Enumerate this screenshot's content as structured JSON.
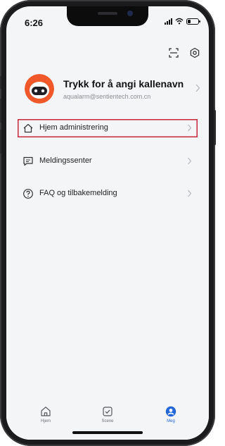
{
  "status_bar": {
    "time": "6:26",
    "battery_level": 0.3
  },
  "top_actions": {
    "scan_icon": "scan-icon",
    "settings_icon": "settings-gear-icon"
  },
  "profile": {
    "name": "Trykk for å angi kallenavn",
    "email": "aqualarm@sentientech.com.cn",
    "avatar_icon": "robot-avatar-icon"
  },
  "menu": [
    {
      "label": "Hjem administrering",
      "icon": "home-icon",
      "highlighted": true
    },
    {
      "label": "Meldingssenter",
      "icon": "message-icon",
      "highlighted": false
    },
    {
      "label": "FAQ og tilbakemelding",
      "icon": "help-icon",
      "highlighted": false
    }
  ],
  "tabs": [
    {
      "label": "Hjem",
      "icon": "home-icon",
      "active": false
    },
    {
      "label": "Scene",
      "icon": "scene-icon",
      "active": false
    },
    {
      "label": "Meg",
      "icon": "profile-icon",
      "active": true
    }
  ],
  "colors": {
    "accent": "#2267d8",
    "highlight": "#c8283c",
    "avatar": "#f0582a"
  }
}
